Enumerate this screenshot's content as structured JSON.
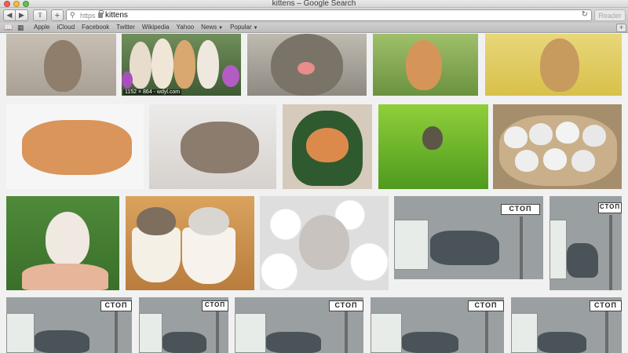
{
  "window": {
    "title": "kittens – Google Search"
  },
  "toolbar": {
    "back_glyph": "◀",
    "forward_glyph": "▶",
    "share_glyph": "⇪",
    "plus_glyph": "+",
    "address": {
      "scheme": "https",
      "query": "kittens"
    },
    "reload_glyph": "↻",
    "reader_label": "Reader"
  },
  "bookmarks": {
    "items": [
      {
        "label": "Apple"
      },
      {
        "label": "iCloud"
      },
      {
        "label": "Facebook"
      },
      {
        "label": "Twitter"
      },
      {
        "label": "Wikipedia"
      },
      {
        "label": "Yahoo"
      },
      {
        "label": "News",
        "has_menu": true
      },
      {
        "label": "Popular",
        "has_menu": true
      }
    ]
  },
  "results": {
    "hover_caption": "1152 × 864 - wdyl.com",
    "sign_text": "СТОП"
  },
  "icons": {
    "book": "book-icon",
    "grid": "top-sites-grid-icon",
    "search": "magnifier-icon",
    "lock": "lock-icon"
  },
  "colors": {
    "toolbar": "#c9c9c9",
    "page_bg": "#f1f1f1"
  }
}
